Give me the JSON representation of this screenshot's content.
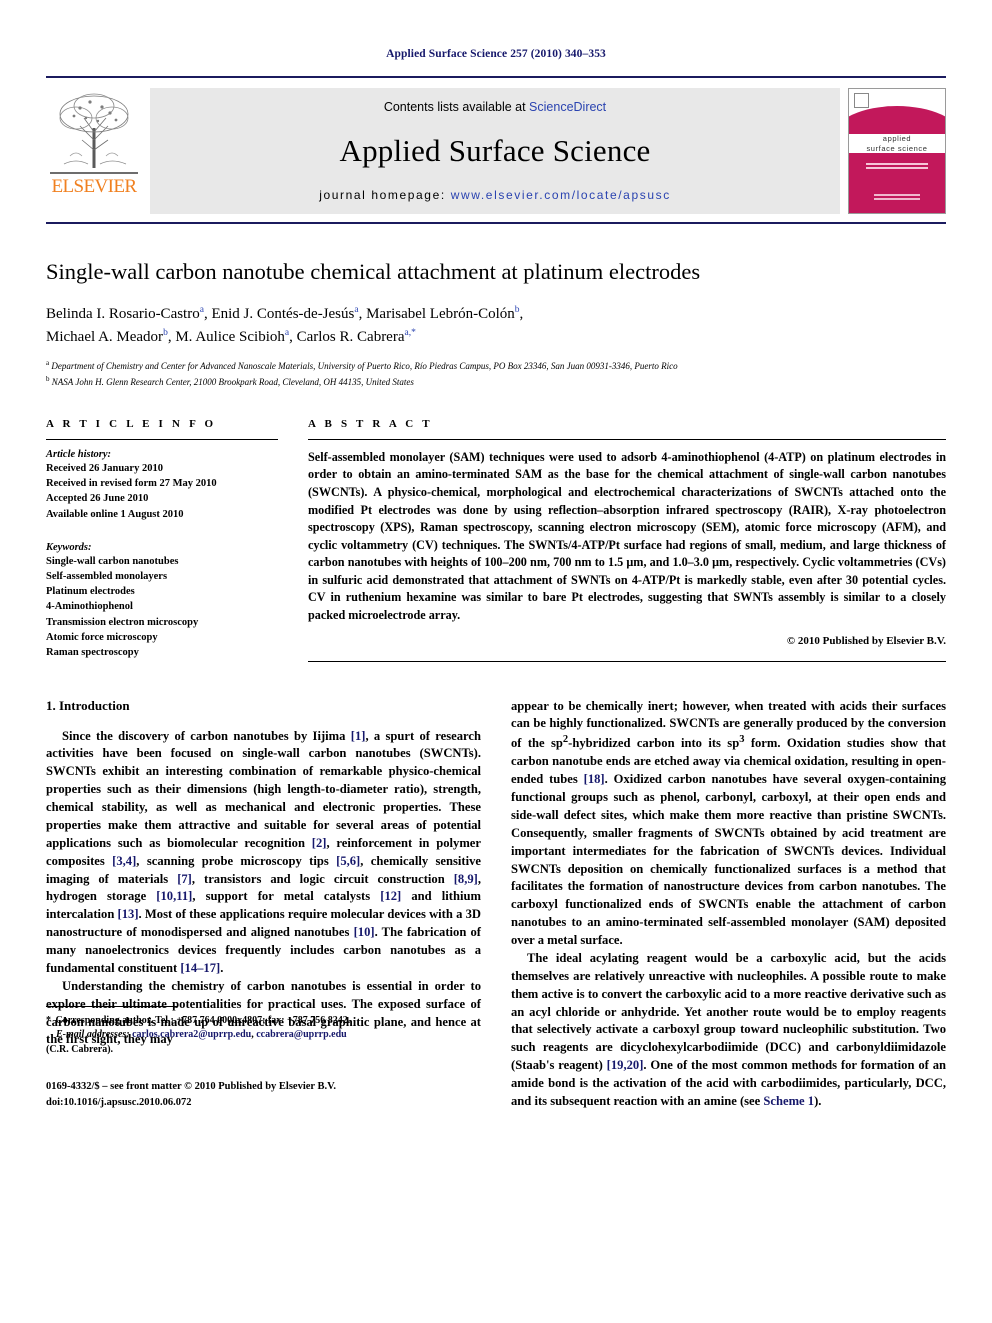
{
  "running_head": "Applied Surface Science 257 (2010) 340–353",
  "masthead": {
    "publisher_name": "ELSEVIER",
    "contents_prefix": "Contents lists available at ",
    "contents_link": "ScienceDirect",
    "journal_title": "Applied Surface Science",
    "homepage_prefix": "journal homepage: ",
    "homepage_url": "www.elsevier.com/locate/apsusc",
    "cover_title_line1": "applied",
    "cover_title_line2": "surface science"
  },
  "article": {
    "title": "Single-wall carbon nanotube chemical attachment at platinum electrodes",
    "authors_line1_a": "Belinda I. Rosario-Castro",
    "authors_line1_a_sup": "a",
    "authors_line1_b": "Enid J. Contés-de-Jesús",
    "authors_line1_b_sup": "a",
    "authors_line1_c": "Marisabel Lebrón-Colón",
    "authors_line1_c_sup": "b",
    "authors_line2_a": "Michael A. Meador",
    "authors_line2_a_sup": "b",
    "authors_line2_b": "M. Aulice Scibioh",
    "authors_line2_b_sup": "a",
    "authors_line2_c": "Carlos R. Cabrera",
    "authors_line2_c_sup": "a,*",
    "affiliation_a_sup": "a",
    "affiliation_a": "Department of Chemistry and Center for Advanced Nanoscale Materials, University of Puerto Rico, Río Piedras Campus, PO Box 23346, San Juan 00931-3346, Puerto Rico",
    "affiliation_b_sup": "b",
    "affiliation_b": "NASA John H. Glenn Research Center, 21000 Brookpark Road, Cleveland, OH 44135, United States"
  },
  "article_info": {
    "heading": "A R T I C L E    I N F O",
    "history_label": "Article history:",
    "history": [
      "Received 26 January 2010",
      "Received in revised form 27 May 2010",
      "Accepted 26 June 2010",
      "Available online 1 August 2010"
    ],
    "keywords_label": "Keywords:",
    "keywords": [
      "Single-wall carbon nanotubes",
      "Self-assembled monolayers",
      "Platinum electrodes",
      "4-Aminothiophenol",
      "Transmission electron microscopy",
      "Atomic force microscopy",
      "Raman spectroscopy"
    ]
  },
  "abstract": {
    "heading": "A B S T R A C T",
    "text": "Self-assembled monolayer (SAM) techniques were used to adsorb 4-aminothiophenol (4-ATP) on platinum electrodes in order to obtain an amino-terminated SAM as the base for the chemical attachment of single-wall carbon nanotubes (SWCNTs). A physico-chemical, morphological and electrochemical characterizations of SWCNTs attached onto the modified Pt electrodes was done by using reflection–absorption infrared spectroscopy (RAIR), X-ray photoelectron spectroscopy (XPS), Raman spectroscopy, scanning electron microscopy (SEM), atomic force microscopy (AFM), and cyclic voltammetry (CV) techniques. The SWNTs/4-ATP/Pt surface had regions of small, medium, and large thickness of carbon nanotubes with heights of 100–200 nm, 700 nm to 1.5 μm, and 1.0–3.0 μm, respectively. Cyclic voltammetries (CVs) in sulfuric acid demonstrated that attachment of SWNTs on 4-ATP/Pt is markedly stable, even after 30 potential cycles. CV in ruthenium hexamine was similar to bare Pt electrodes, suggesting that SWNTs assembly is similar to a closely packed microelectrode array.",
    "copyright": "© 2010 Published by Elsevier B.V."
  },
  "body": {
    "section_title": "1.  Introduction",
    "left_para1_pre": "Since the discovery of carbon nanotubes by Iijima ",
    "left_para1_ref1": "[1]",
    "left_para1_mid1": ", a spurt of research activities have been focused on single-wall carbon nanotubes (SWCNTs). SWCNTs exhibit an interesting combination of remarkable physico-chemical properties such as their dimensions (high length-to-diameter ratio), strength, chemical stability, as well as mechanical and electronic properties. These properties make them attractive and suitable for several areas of potential applications such as biomolecular recognition ",
    "left_para1_ref2": "[2]",
    "left_para1_mid2": ", reinforcement in polymer composites ",
    "left_para1_ref3": "[3,4]",
    "left_para1_mid3": ", scanning probe microscopy tips ",
    "left_para1_ref4": "[5,6]",
    "left_para1_mid4": ", chemically sensitive imaging of materials ",
    "left_para1_ref5": "[7]",
    "left_para1_mid5": ", transistors and logic circuit construction ",
    "left_para1_ref6": "[8,9]",
    "left_para1_mid6": ", hydrogen storage ",
    "left_para1_ref7": "[10,11]",
    "left_para1_mid7": ", support for metal catalysts ",
    "left_para1_ref8": "[12]",
    "left_para1_mid8": " and lithium intercalation ",
    "left_para1_ref9": "[13]",
    "left_para1_mid9": ". Most of these applications require molecular devices with a 3D nanostructure of monodispersed and aligned nanotubes ",
    "left_para1_ref10": "[10]",
    "left_para1_mid10": ". The fabrication of many nanoelectronics devices frequently includes carbon nanotubes as a fundamental constituent ",
    "left_para1_ref11": "[14–17]",
    "left_para1_end": ".",
    "left_para2": "Understanding the chemistry of carbon nanotubes is essential in order to explore their ultimate potentialities for practical uses. The exposed surface of carbon nanotubes is made up of unreactive basal graphitic plane, and hence at the first sight, they may",
    "right_para1_pre": "appear to be chemically inert; however, when treated with acids their surfaces can be highly functionalized. SWCNTs are generally produced by the conversion of the sp",
    "right_sup2": "2",
    "right_para1_mid1": "-hybridized carbon into its sp",
    "right_sup3": "3",
    "right_para1_mid2": " form. Oxidation studies show that carbon nanotube ends are etched away via chemical oxidation, resulting in open-ended tubes ",
    "right_para1_ref1": "[18]",
    "right_para1_mid3": ". Oxidized carbon nanotubes have several oxygen-containing functional groups such as phenol, carbonyl, carboxyl, at their open ends and side-wall defect sites, which make them more reactive than pristine SWCNTs. Consequently, smaller fragments of SWCNTs obtained by acid treatment are important intermediates for the fabrication of SWCNTs devices. Individual SWCNTs deposition on chemically functionalized surfaces is a method that facilitates the formation of nanostructure devices from carbon nanotubes. The carboxyl functionalized ends of SWCNTs enable the attachment of carbon nanotubes to an amino-terminated self-assembled monolayer (SAM) deposited over a metal surface.",
    "right_para2_pre": "The ideal acylating reagent would be a carboxylic acid, but the acids themselves are relatively unreactive with nucleophiles. A possible route to make them active is to convert the carboxylic acid to a more reactive derivative such as an acyl chloride or anhydride. Yet another route would be to employ reagents that selectively activate a carboxyl group toward nucleophilic substitution. Two such reagents are dicyclohexylcarbodiimide (DCC) and carbonyldiimidazole (Staab's reagent) ",
    "right_para2_ref1": "[19,20]",
    "right_para2_mid1": ". One of the most common methods for formation of an amide bond is the activation of the acid with carbodiimides, particularly, DCC, and its subsequent reaction with an amine (see ",
    "right_para2_link": "Scheme 1",
    "right_para2_end": ")."
  },
  "footnote": {
    "star": "*",
    "corresponding": " Corresponding author. Tel.: +787 764 0000x4807; fax: +787 756 8242.",
    "email_label": "E-mail addresses:",
    "email1": "carlos.cabrera2@uprrp.edu",
    "email_sep": ", ",
    "email2": "ccabrera@uprrp.edu",
    "email_owner": "(C.R. Cabrera).",
    "issn_line": "0169-4332/$ – see front matter © 2010 Published by Elsevier B.V.",
    "doi_line": "doi:10.1016/j.apsusc.2010.06.072"
  },
  "colors": {
    "running_head": "#16186b",
    "link_blue": "#2a43b0",
    "ref_blue": "#16186b",
    "elsevier_orange": "#f08020",
    "cover_crimson": "#c2185b",
    "masthead_gray": "#e8e8e8"
  }
}
